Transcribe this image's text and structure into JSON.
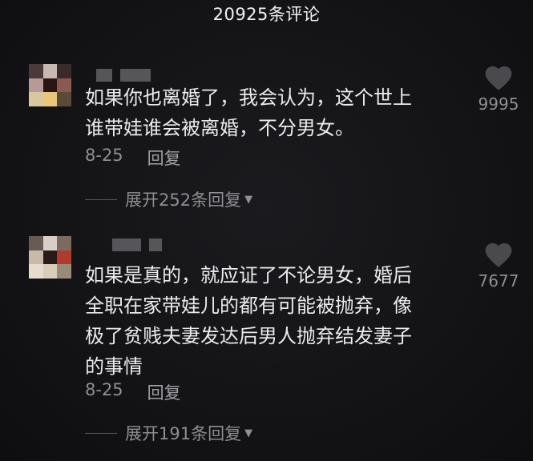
{
  "header": {
    "title": "20925条评论"
  },
  "comments": [
    {
      "text_line1": "如果你也离婚了，我会认为，这个世上",
      "text_line2": "谁带娃谁会被离婚，不分男女。",
      "date": "8-25",
      "reply_label": "回复",
      "expand_label": "展开252条回复",
      "likes": "9995",
      "icon": "heart-icon"
    },
    {
      "text_line1": "如果是真的，就应证了不论男女，婚后",
      "text_line2": "全职在家带娃儿的都有可能被抛弃，像",
      "text_line3": "极了贫贱夫妻发达后男人抛弃结发妻子",
      "text_line4": "的事情",
      "date": "8-25",
      "reply_label": "回复",
      "expand_label": "展开191条回复",
      "likes": "7677",
      "icon": "heart-icon"
    }
  ],
  "colors": {
    "background": "#141416",
    "text": "#ececee",
    "muted": "#8e8e93",
    "heart": "#4a4a4e"
  }
}
